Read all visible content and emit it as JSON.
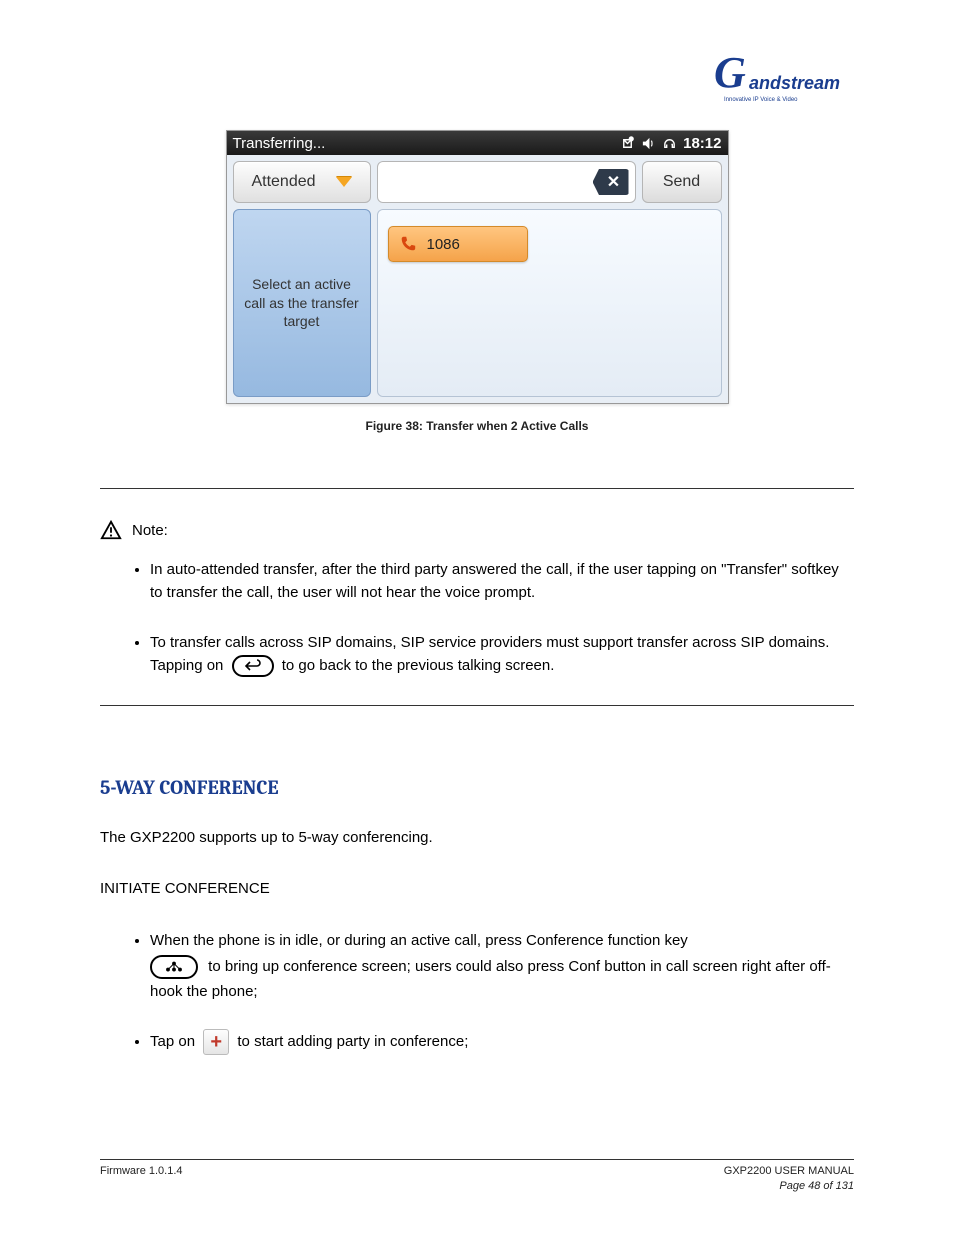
{
  "logo": {
    "brand": "andstream",
    "tagline": "Innovative IP Voice & Video"
  },
  "screenshot": {
    "statusbar": {
      "title": "Transferring...",
      "time": "18:12"
    },
    "attended_label": "Attended",
    "send_label": "Send",
    "backspace_glyph": "✕",
    "left_panel_text": "Select an active call as the transfer target",
    "call_chip_number": "1086"
  },
  "figure_caption": "Figure 38: Transfer when 2 Active Calls",
  "note": {
    "heading": "Note:",
    "items": [
      "In auto-attended transfer, after the third party answered the call, if the user tapping on \"Transfer\" softkey to transfer the call, the user will not hear the voice prompt.",
      {
        "pre": "To transfer calls across SIP domains, SIP service providers must support transfer across SIP domains. Tapping on",
        "post": "to go back to the previous talking screen."
      }
    ]
  },
  "section": {
    "heading": "5-WAY CONFERENCE",
    "intro": "The GXP2200 supports up to 5-way conferencing.",
    "subheading": "INITIATE CONFERENCE",
    "bullets": [
      {
        "pre": "When the phone is in idle, or during an active call, press Conference function key",
        "mid": "to bring up conference screen; users could also press Conf button in call screen right after off-hook the phone;"
      },
      {
        "pre": "Tap on",
        "post": "to start adding party in conference;"
      }
    ]
  },
  "footer": {
    "firmware": "Firmware 1.0.1.4",
    "company": "GXP2200 USER MANUAL",
    "page": "Page 48 of 131"
  }
}
